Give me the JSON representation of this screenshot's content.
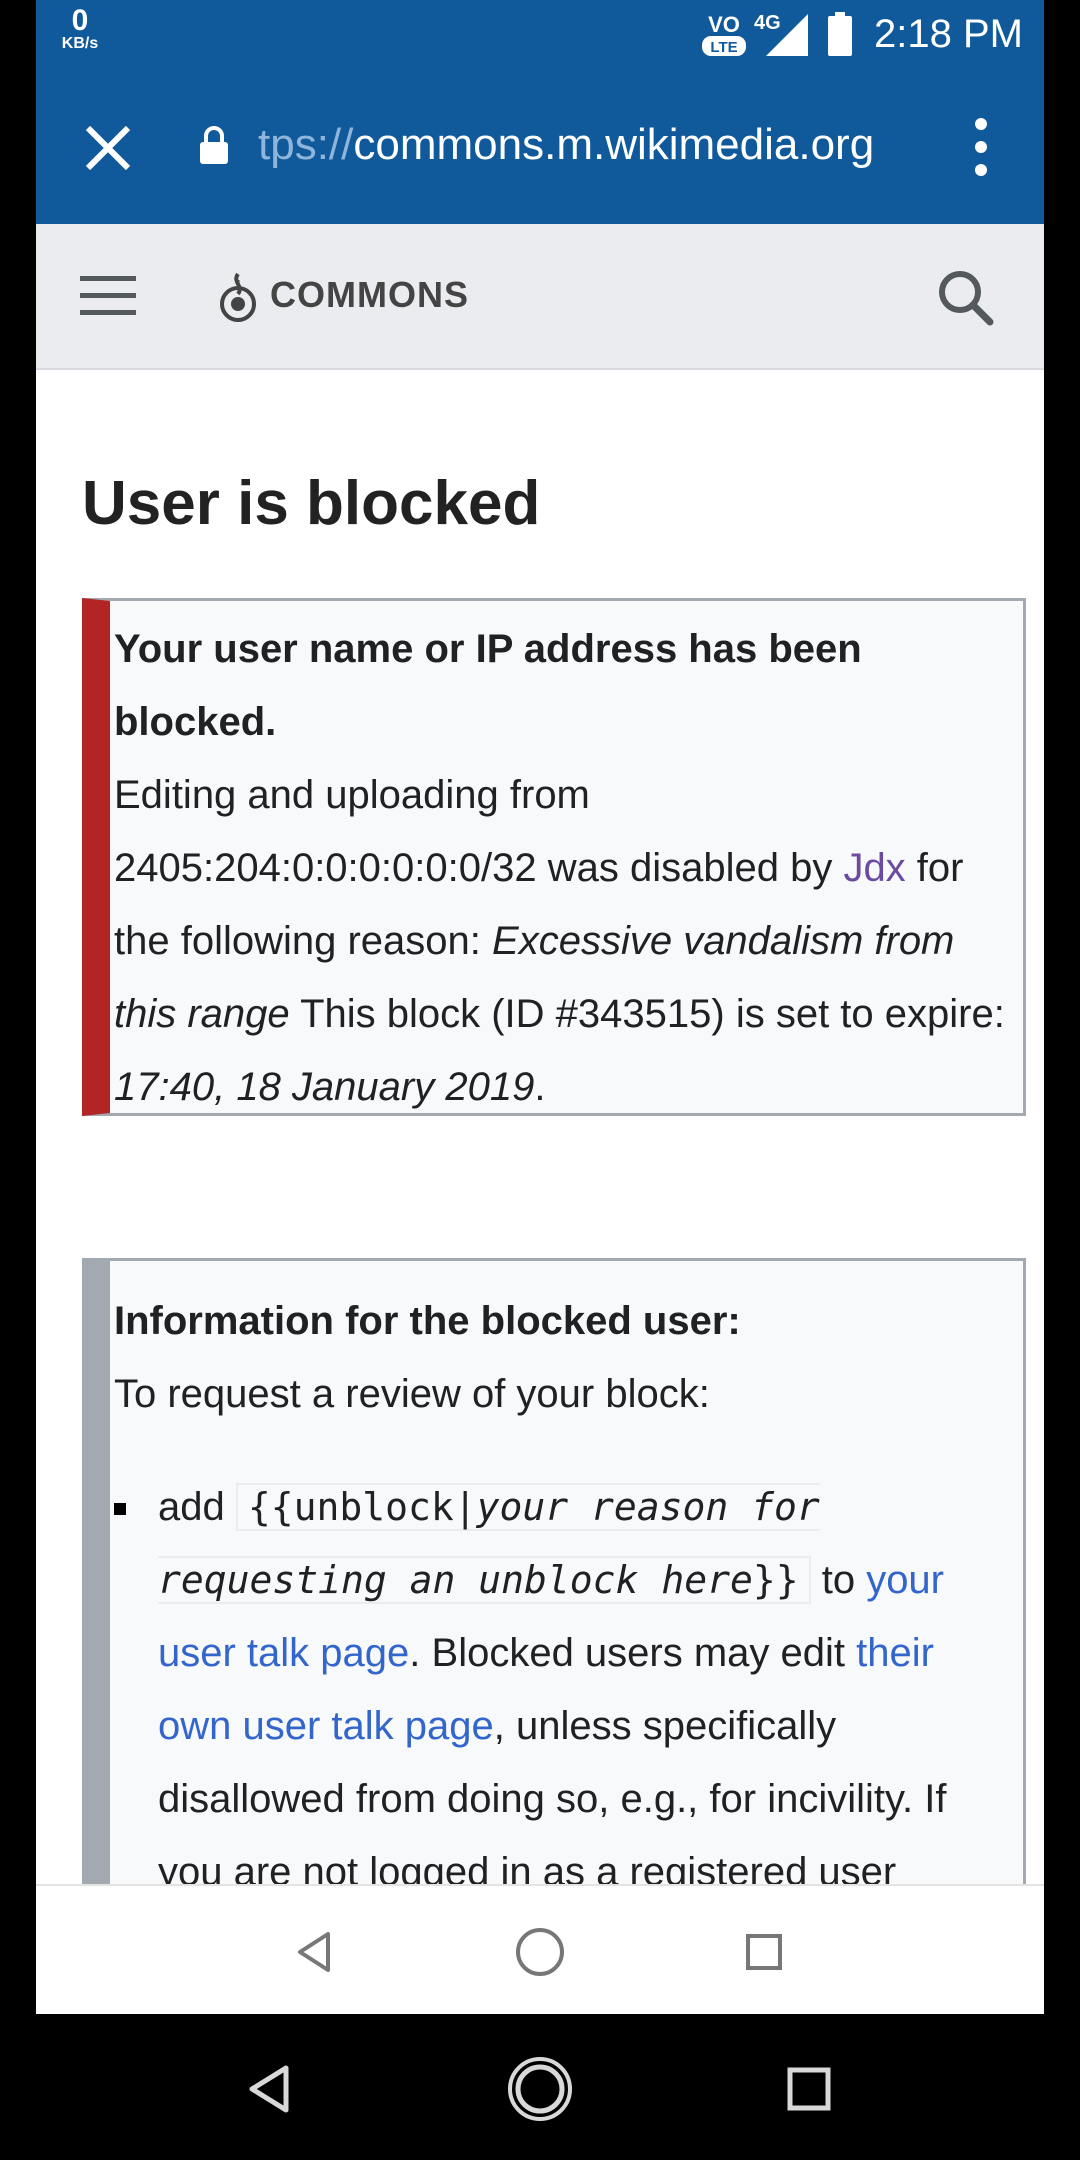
{
  "status_bar": {
    "speed_value": "0",
    "speed_unit": "KB/s",
    "volte_label": "VO",
    "lte_label": "LTE",
    "network_type": "4G",
    "time": "2:18 PM"
  },
  "browser": {
    "url_scheme": "tps://",
    "url_host": "commons.m.wikimedia.org",
    "icons": [
      "close-icon",
      "lock-icon",
      "more-vert-icon"
    ]
  },
  "header": {
    "logo_text": "COMMONS",
    "icons": [
      "menu-icon",
      "commons-logo-icon",
      "search-icon"
    ]
  },
  "page": {
    "title": "User is blocked"
  },
  "block_notice": {
    "heading": "Your user name or IP address has been blocked.",
    "text1": "Editing and uploading from 2405:204:0:0:0:0:0:0/32 was disabled by ",
    "blocker": "Jdx",
    "text2": " for the following reason: ",
    "reason": "Excessive vandalism from this range",
    "text3": " This block (ID #343515) is set to expire: ",
    "expiry": "17:40, 18 January 2019",
    "text4": "."
  },
  "info_box": {
    "heading": "Information for the blocked user:",
    "intro": "To request a review of your block:",
    "item_add": "add ",
    "code_open": "{{unblock|",
    "code_italic": "your reason for requesting an unblock here",
    "code_close": "}}",
    "item_to": " to ",
    "link_talk": "your user talk page",
    "text_after_link": ". Blocked users may edit ",
    "link_own_talk": "their own user talk page",
    "text_unless": ", unless specifically disallowed from doing so, e.g., for incivility. ",
    "text_cut": "If you are not logged in as a registered user"
  },
  "colors": {
    "browser_bar": "#105a9b",
    "block_border": "#b32424",
    "info_border": "#a2a9b1",
    "link": "#3366cc",
    "visited_link": "#6b4ba1"
  },
  "nav": {
    "icons": [
      "back-icon",
      "home-icon",
      "recents-icon"
    ]
  }
}
